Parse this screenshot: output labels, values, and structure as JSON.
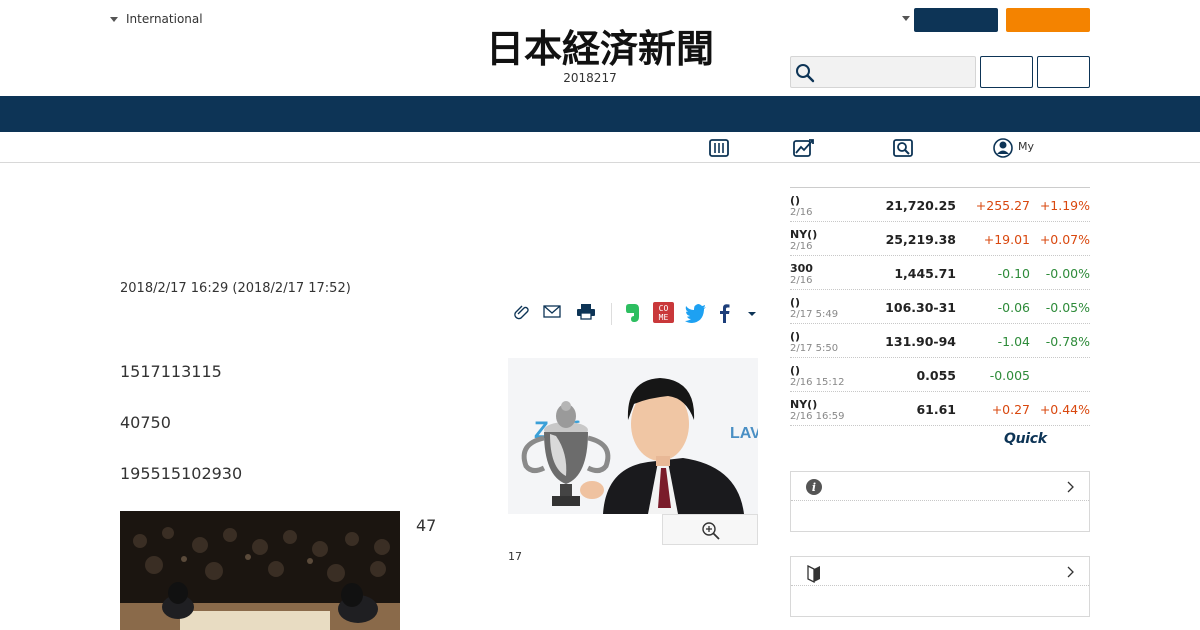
{
  "header": {
    "edition_selector": "International",
    "logo_text": "日本経済新聞",
    "edition_date": "2018217",
    "colors": {
      "navy": "#0d3456",
      "orange": "#f48300"
    }
  },
  "subnav": {
    "my_label": "My"
  },
  "article": {
    "date": "2018/2/17 16:29 (2018/2/17 17:52)",
    "paragraphs": [
      "1517113115",
      "40750",
      "195515102930"
    ],
    "side_text": "47",
    "caption": "17"
  },
  "share": {
    "icons": [
      "clip-icon",
      "mail-icon",
      "print-icon",
      "evernote-icon",
      "come-icon",
      "twitter-icon",
      "facebook-icon",
      "more-icon"
    ],
    "come_label": "COME"
  },
  "markets": [
    {
      "name": "()",
      "time": "2/16",
      "value": "21,720.25",
      "change": "+255.27",
      "pct": "+1.19%",
      "dir": "up"
    },
    {
      "name": "NY()",
      "time": "2/16",
      "value": "25,219.38",
      "change": "+19.01",
      "pct": "+0.07%",
      "dir": "up"
    },
    {
      "name": "300",
      "time": "2/16",
      "value": "1,445.71",
      "change": "-0.10",
      "pct": "-0.00%",
      "dir": "down"
    },
    {
      "name": "()",
      "time": "2/17 5:49",
      "value": "106.30-31",
      "change": "-0.06",
      "pct": "-0.05%",
      "dir": "down"
    },
    {
      "name": "()",
      "time": "2/17 5:50",
      "value": "131.90-94",
      "change": "-1.04",
      "pct": "-0.78%",
      "dir": "down"
    },
    {
      "name": "()",
      "time": "2/16 15:12",
      "value": "0.055",
      "change": "-0.005",
      "pct": "",
      "dir": "down"
    },
    {
      "name": "NY()",
      "time": "2/16 16:59",
      "value": "61.61",
      "change": "+0.27",
      "pct": "+0.44%",
      "dir": "up"
    }
  ],
  "quick_logo": "Quick",
  "photo_main": {
    "logo_left": "Zoff",
    "logo_right": "LAV"
  }
}
